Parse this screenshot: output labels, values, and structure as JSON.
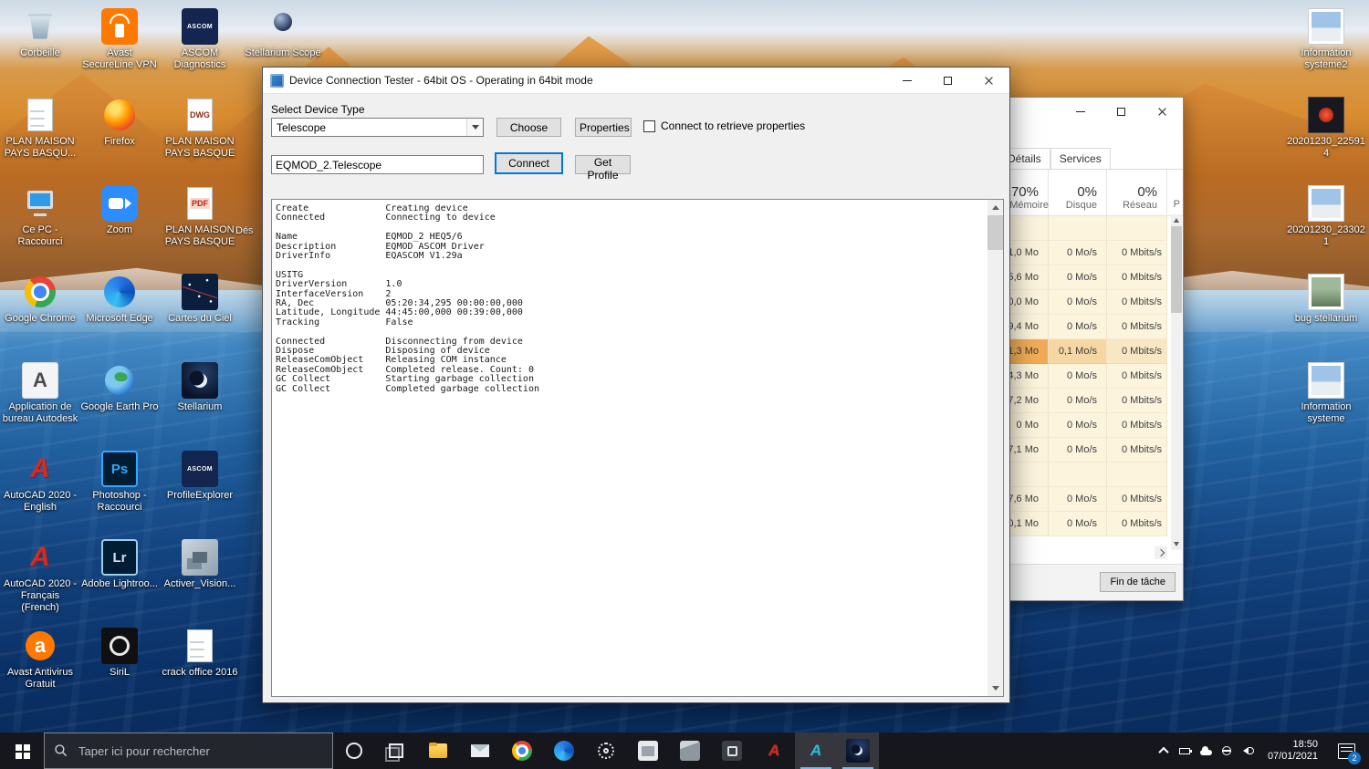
{
  "desktop": {
    "col1": [
      {
        "label": "Corbeille",
        "icon": "recycle-bin"
      },
      {
        "label": "PLAN MAISON PAYS BASQU...",
        "icon": "doc"
      },
      {
        "label": "Ce PC - Raccourci",
        "icon": "pc"
      },
      {
        "label": "Google Chrome",
        "icon": "chrome"
      },
      {
        "label": "Application de bureau Autodesk",
        "icon": "autodesk"
      },
      {
        "label": "AutoCAD 2020 - English",
        "icon": "autocad"
      },
      {
        "label": "AutoCAD 2020 - Français (French)",
        "icon": "autocad"
      },
      {
        "label": "Avast Antivirus Gratuit",
        "icon": "avast"
      }
    ],
    "col2": [
      {
        "label": "Avast SecureLine VPN",
        "icon": "avast-vpn"
      },
      {
        "label": "Firefox",
        "icon": "firefox"
      },
      {
        "label": "Zoom",
        "icon": "zoom"
      },
      {
        "label": "Microsoft Edge",
        "icon": "edge"
      },
      {
        "label": "Google Earth Pro",
        "icon": "google-earth"
      },
      {
        "label": "Photoshop - Raccourci",
        "icon": "photoshop"
      },
      {
        "label": "Adobe Lightroo...",
        "icon": "lightroom"
      },
      {
        "label": "SiriL",
        "icon": "siril"
      }
    ],
    "col3": [
      {
        "label": "ASCOM Diagnostics",
        "icon": "ascom"
      },
      {
        "label": "PLAN MAISON PAYS BASQUE",
        "icon": "dwg"
      },
      {
        "label": "PLAN MAISON PAYS BASQUE",
        "icon": "pdf"
      },
      {
        "label": "Cartes du Ciel",
        "icon": "cartes-ciel"
      },
      {
        "label": "Stellarium",
        "icon": "stellarium"
      },
      {
        "label": "ProfileExplorer",
        "icon": "ascom"
      },
      {
        "label": "Activer_Vision...",
        "icon": "activer"
      },
      {
        "label": "crack office 2016",
        "icon": "doc"
      }
    ],
    "col4": [
      {
        "label": "Stellarium Scope",
        "icon": "stellarium-scope"
      }
    ],
    "partial_label": "Dés",
    "right_col": [
      {
        "label": "Information systeme2",
        "icon": "photo"
      },
      {
        "label": "20201230_225914",
        "icon": "photo-red"
      },
      {
        "label": "20201230_233021",
        "icon": "photo"
      },
      {
        "label": "bug stellarium",
        "icon": "photo-green"
      },
      {
        "label": "Information systeme",
        "icon": "photo"
      }
    ]
  },
  "window": {
    "title": "Device Connection Tester - 64bit OS - Operating in 64bit mode",
    "controls": {
      "select_device_label": "Select Device Type",
      "device_type_value": "Telescope",
      "choose": "Choose",
      "properties": "Properties",
      "retrieve_checkbox": "Connect to retrieve properties",
      "device_id": "EQMOD_2.Telescope",
      "connect": "Connect",
      "get_profile": "Get Profile"
    },
    "log": [
      "Create              Creating device",
      "Connected           Connecting to device",
      "",
      "Name                EQMOD_2 HEQ5/6",
      "Description         EQMOD ASCOM Driver",
      "DriverInfo          EQASCOM V1.29a",
      "",
      "USITG",
      "DriverVersion       1.0",
      "InterfaceVersion    2",
      "RA, Dec             05:20:34,295 00:00:00,000",
      "Latitude, Longitude 44:45:00,000 00:39:00,000",
      "Tracking            False",
      "",
      "Connected           Disconnecting from device",
      "Dispose             Disposing of device",
      "ReleaseComObject    Releasing COM instance",
      "ReleaseComObject    Completed release. Count: 0",
      "GC Collect          Starting garbage collection",
      "GC Collect          Completed garbage collection"
    ]
  },
  "task_manager": {
    "tabs": [
      "Détails",
      "Services"
    ],
    "columns": [
      {
        "pct": "70%",
        "label": "Mémoire"
      },
      {
        "pct": "0%",
        "label": "Disque"
      },
      {
        "pct": "0%",
        "label": "Réseau"
      }
    ],
    "partial_column": "P",
    "rows": [
      {
        "mem": "",
        "disk": "",
        "net": ""
      },
      {
        "mem": "1,0 Mo",
        "disk": "0 Mo/s",
        "net": "0 Mbits/s"
      },
      {
        "mem": "5,6 Mo",
        "disk": "0 Mo/s",
        "net": "0 Mbits/s"
      },
      {
        "mem": "0,0 Mo",
        "disk": "0 Mo/s",
        "net": "0 Mbits/s"
      },
      {
        "mem": "9,4 Mo",
        "disk": "0 Mo/s",
        "net": "0 Mbits/s"
      },
      {
        "mem": "1,3 Mo",
        "disk": "0,1 Mo/s",
        "net": "0 Mbits/s",
        "mod": "hot"
      },
      {
        "mem": "4,3 Mo",
        "disk": "0 Mo/s",
        "net": "0 Mbits/s"
      },
      {
        "mem": "7,2 Mo",
        "disk": "0 Mo/s",
        "net": "0 Mbits/s"
      },
      {
        "mem": "0 Mo",
        "disk": "0 Mo/s",
        "net": "0 Mbits/s"
      },
      {
        "mem": "7,1 Mo",
        "disk": "0 Mo/s",
        "net": "0 Mbits/s"
      },
      {
        "mem": "",
        "disk": "",
        "net": ""
      },
      {
        "mem": "7,6 Mo",
        "disk": "0 Mo/s",
        "net": "0 Mbits/s"
      },
      {
        "mem": "0,1 Mo",
        "disk": "0 Mo/s",
        "net": "0 Mbits/s"
      }
    ],
    "end_task_label": "Fin de tâche"
  },
  "taskbar": {
    "search_placeholder": "Taper ici pour rechercher",
    "apps": [
      {
        "icon": "cortana"
      },
      {
        "icon": "task-view"
      },
      {
        "icon": "explorer"
      },
      {
        "icon": "mail"
      },
      {
        "icon": "chrome"
      },
      {
        "icon": "edge"
      },
      {
        "icon": "settings-gear"
      },
      {
        "icon": "app-light"
      },
      {
        "icon": "app-cube"
      },
      {
        "icon": "app-dark"
      },
      {
        "icon": "autocad"
      },
      {
        "icon": "autocad-teal",
        "mod": "active"
      },
      {
        "icon": "stellarium",
        "mod": "active"
      }
    ],
    "tray_icons": [
      {
        "icon": "chevron-up"
      },
      {
        "icon": "battery"
      },
      {
        "icon": "cloud"
      },
      {
        "icon": "network"
      },
      {
        "icon": "volume"
      }
    ],
    "clock": {
      "time": "18:50",
      "date": "07/01/2021"
    },
    "notification_count": "2"
  },
  "colors": {
    "accent": "#0078d7",
    "taskbar_bg": "#15171c",
    "heatmap_cell": "#fcf4dd",
    "heatmap_hot": "#f1ad56"
  }
}
